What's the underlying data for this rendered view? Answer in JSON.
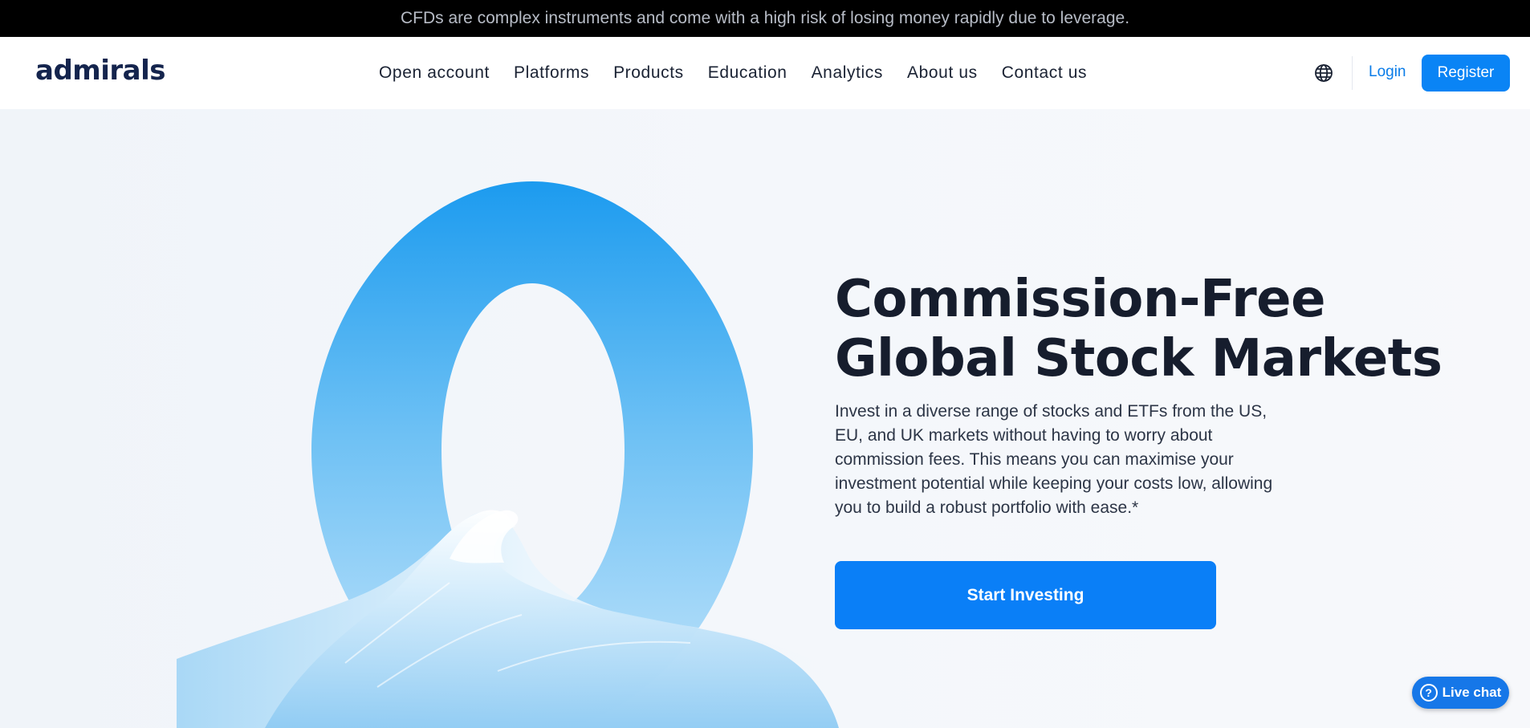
{
  "risk_warning": "CFDs are complex instruments and come with a high risk of losing money rapidly due to leverage.",
  "header": {
    "logo": "admirals",
    "nav": [
      {
        "label": "Open account"
      },
      {
        "label": "Platforms"
      },
      {
        "label": "Products"
      },
      {
        "label": "Education"
      },
      {
        "label": "Analytics"
      },
      {
        "label": "About us"
      },
      {
        "label": "Contact us"
      }
    ],
    "language_icon": "globe-icon",
    "login_label": "Login",
    "register_label": "Register"
  },
  "hero": {
    "graphic_text": "0",
    "title_line1": "Commission-Free",
    "title_line2": "Global Stock Markets",
    "description": "Invest in a diverse range of stocks and ETFs from the US, EU, and UK markets without having to worry about commission fees. This means you can maximise your investment potential while keeping your costs low, allowing you to build a robust portfolio with ease.*",
    "cta_label": "Start Investing"
  },
  "chat": {
    "icon": "help-circle-icon",
    "label": "Live chat"
  },
  "colors": {
    "accent": "#0a7ff7",
    "brand_dark": "#14244d",
    "risk_bar": "#000000"
  }
}
